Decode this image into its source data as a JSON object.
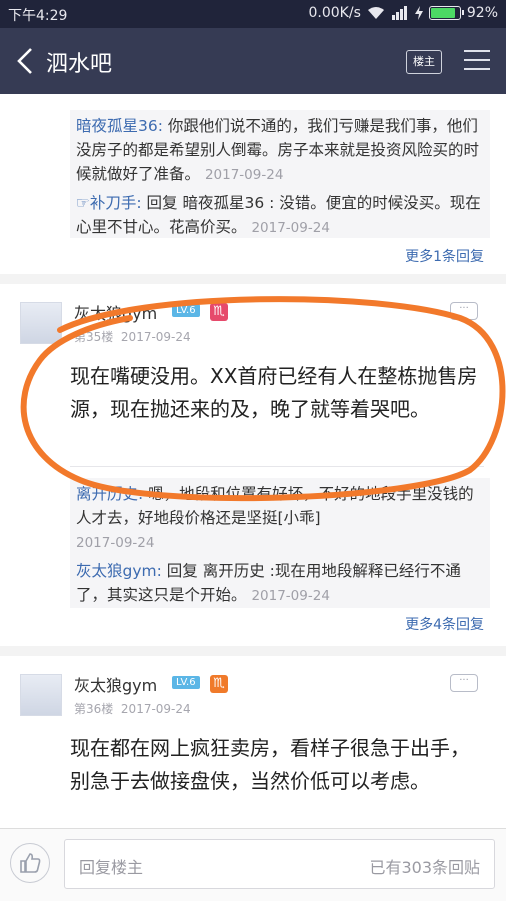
{
  "status": {
    "time": "下午4:29",
    "speed": "0.00K/s",
    "battery": "92%",
    "battery_level": 0.92
  },
  "header": {
    "title": "泗水吧",
    "louzhu_label": "楼主"
  },
  "thread": {
    "top_replies": [
      {
        "name": "暗夜孤星36:",
        "text": " 你跟他们说不通的，我们亏赚是我们事，他们没房子的都是希望别人倒霉。房子本来就是投资风险买的时候就做好了准备。",
        "date": "2017-09-24"
      },
      {
        "name": "☞补刀手:",
        "text": " 回复 暗夜孤星36 : 没错。便宜的时候没买。现在心里不甘心。花高价买。",
        "date": "2017-09-24"
      }
    ],
    "top_more": "更多1条回复",
    "post1": {
      "username": "灰太狼gym",
      "level": "LV.6",
      "floor": "第35楼",
      "date": "2017-09-24",
      "body": "现在嘴硬没用。XX首府已经有人在整栋抛售房源，现在抛还来的及，晚了就等着哭吧。",
      "replies": [
        {
          "name": "离开历史:",
          "text": " 嗯，地段和位置有好坏，不好的地段手里没钱的人才去，好地段价格还是坚挺[小乖]",
          "date": "2017-09-24"
        },
        {
          "name": "灰太狼gym:",
          "text": " 回复 离开历史 :现在用地段解释已经行不通了，其实这只是个开始。",
          "date": "2017-09-24"
        }
      ],
      "more": "更多4条回复"
    },
    "post2": {
      "username": "灰太狼gym",
      "level": "LV.6",
      "floor": "第36楼",
      "date": "2017-09-24",
      "body": "现在都在网上疯狂卖房，看样子很急于出手，别急于去做接盘侠，当然价低可以考虑。"
    }
  },
  "bottom": {
    "placeholder": "回复楼主",
    "count_label": "已有303条回贴"
  }
}
